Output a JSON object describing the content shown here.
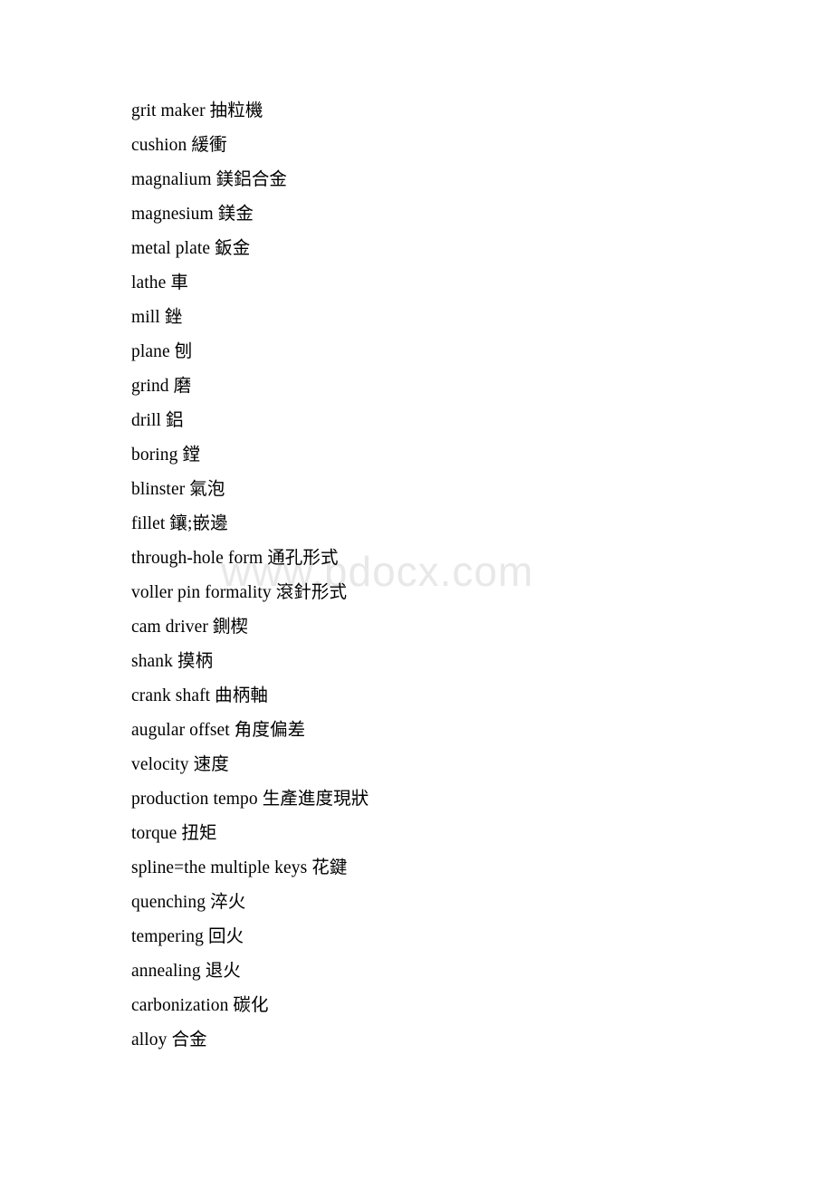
{
  "document": {
    "watermark": "www.bdocx.com",
    "entries": [
      {
        "term": "grit maker",
        "gloss": "抽粒機"
      },
      {
        "term": "cushion",
        "gloss": "緩衝"
      },
      {
        "term": "magnalium",
        "gloss": "鎂鋁合金"
      },
      {
        "term": "magnesium",
        "gloss": "鎂金"
      },
      {
        "term": "metal plate",
        "gloss": "鈑金"
      },
      {
        "term": "lathe",
        "gloss": "車"
      },
      {
        "term": "mill",
        "gloss": "銼"
      },
      {
        "term": "plane",
        "gloss": "刨"
      },
      {
        "term": "grind",
        "gloss": "磨"
      },
      {
        "term": "drill",
        "gloss": "鋁"
      },
      {
        "term": "boring",
        "gloss": "鏜"
      },
      {
        "term": "blinster",
        "gloss": "氣泡"
      },
      {
        "term": "fillet",
        "gloss": "鑲;嵌邊"
      },
      {
        "term": "through-hole form",
        "gloss": "通孔形式"
      },
      {
        "term": "voller pin formality",
        "gloss": "滾針形式"
      },
      {
        "term": "cam driver",
        "gloss": "鍘楔"
      },
      {
        "term": "shank",
        "gloss": "摸柄"
      },
      {
        "term": "crank shaft",
        "gloss": "曲柄軸"
      },
      {
        "term": "augular offset",
        "gloss": "角度偏差"
      },
      {
        "term": "velocity",
        "gloss": "速度"
      },
      {
        "term": "production tempo",
        "gloss": "生產進度現狀"
      },
      {
        "term": "torque",
        "gloss": "扭矩"
      },
      {
        "term": "spline=the multiple keys",
        "gloss": "花鍵"
      },
      {
        "term": "quenching",
        "gloss": "淬火"
      },
      {
        "term": "tempering",
        "gloss": "回火"
      },
      {
        "term": "annealing",
        "gloss": "退火"
      },
      {
        "term": "carbonization",
        "gloss": "碳化"
      },
      {
        "term": "alloy",
        "gloss": "合金"
      }
    ]
  }
}
